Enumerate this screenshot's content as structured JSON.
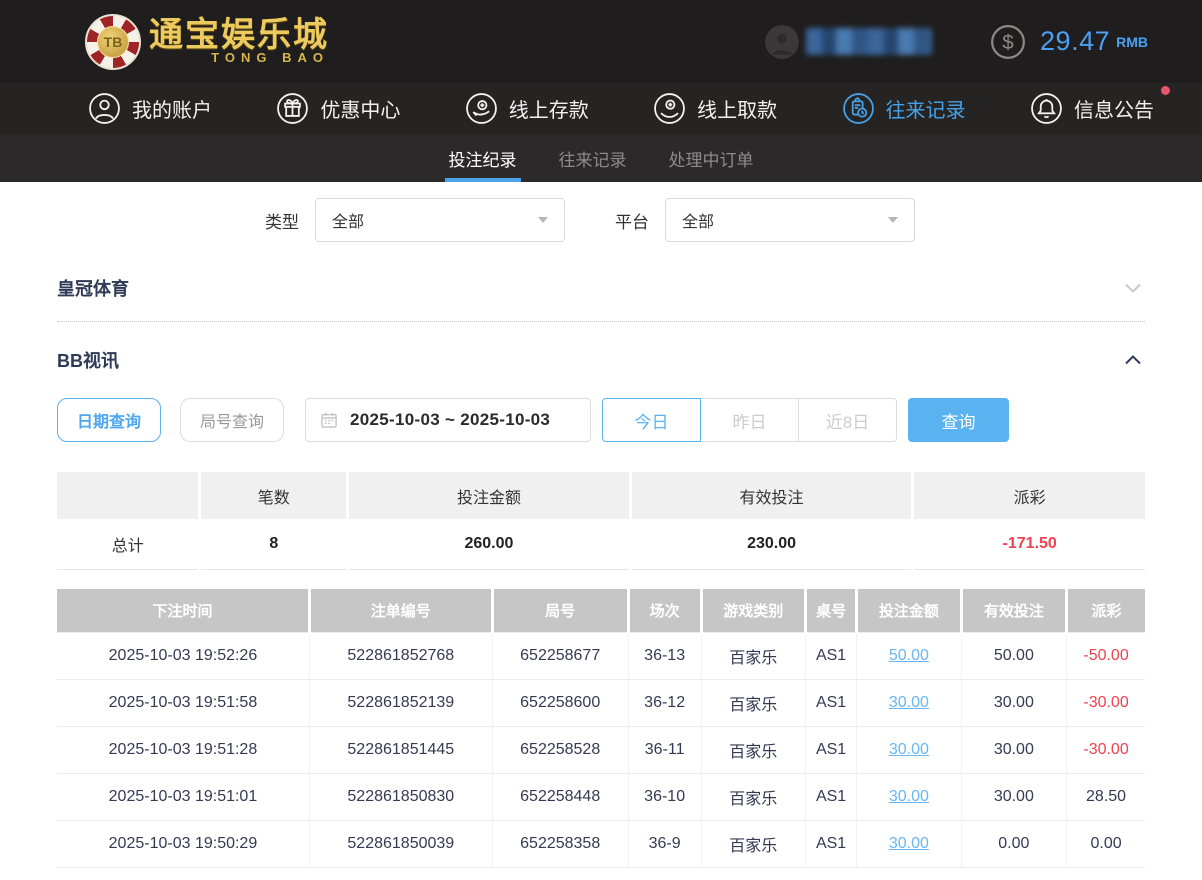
{
  "header": {
    "logo": {
      "chip_text": "TB",
      "name_cn": "通宝娱乐城",
      "name_en": "TONG BAO"
    },
    "balance": {
      "amount": "29.47",
      "currency": "RMB"
    },
    "colors": {
      "accent_blue": "#4aa0f2",
      "button_blue": "#5bb2f0",
      "negative_red": "#f0424f",
      "badge_pink": "#e8546a"
    }
  },
  "nav": {
    "items": [
      {
        "label": "我的账户",
        "icon": "user-icon"
      },
      {
        "label": "优惠中心",
        "icon": "gift-icon"
      },
      {
        "label": "线上存款",
        "icon": "deposit-icon"
      },
      {
        "label": "线上取款",
        "icon": "withdraw-icon"
      },
      {
        "label": "往来记录",
        "icon": "records-icon",
        "active": true
      },
      {
        "label": "信息公告",
        "icon": "bell-icon",
        "has_badge": true
      }
    ]
  },
  "tabs": {
    "items": [
      {
        "label": "投注纪录",
        "active": true
      },
      {
        "label": "往来记录"
      },
      {
        "label": "处理中订单"
      }
    ]
  },
  "filters": {
    "type": {
      "label": "类型",
      "value": "全部"
    },
    "platform": {
      "label": "平台",
      "value": "全部"
    }
  },
  "sections": {
    "crown": {
      "title": "皇冠体育",
      "state": "collapsed"
    },
    "bb": {
      "title": "BB视讯",
      "state": "expanded"
    }
  },
  "query": {
    "date_query_btn": "日期查询",
    "round_query_btn": "局号查询",
    "date_range": "2025-10-03 ~ 2025-10-03",
    "range_buttons": [
      {
        "label": "今日",
        "active": true
      },
      {
        "label": "昨日"
      },
      {
        "label": "近8日"
      }
    ],
    "search_btn": "查询"
  },
  "summary": {
    "headers": [
      "",
      "笔数",
      "投注金额",
      "有效投注",
      "派彩"
    ],
    "total_label": "总计",
    "count": "8",
    "bet_amount": "260.00",
    "valid_bet": "230.00",
    "payout": "-171.50"
  },
  "bet_table": {
    "headers": [
      "下注时间",
      "注单编号",
      "局号",
      "场次",
      "游戏类别",
      "桌号",
      "投注金额",
      "有效投注",
      "派彩"
    ],
    "rows": [
      {
        "time": "2025-10-03 19:52:26",
        "order_id": "522861852768",
        "round": "652258677",
        "session": "36-13",
        "game": "百家乐",
        "table": "AS1",
        "bet": "50.00",
        "valid": "50.00",
        "payout": "-50.00"
      },
      {
        "time": "2025-10-03 19:51:58",
        "order_id": "522861852139",
        "round": "652258600",
        "session": "36-12",
        "game": "百家乐",
        "table": "AS1",
        "bet": "30.00",
        "valid": "30.00",
        "payout": "-30.00"
      },
      {
        "time": "2025-10-03 19:51:28",
        "order_id": "522861851445",
        "round": "652258528",
        "session": "36-11",
        "game": "百家乐",
        "table": "AS1",
        "bet": "30.00",
        "valid": "30.00",
        "payout": "-30.00"
      },
      {
        "time": "2025-10-03 19:51:01",
        "order_id": "522861850830",
        "round": "652258448",
        "session": "36-10",
        "game": "百家乐",
        "table": "AS1",
        "bet": "30.00",
        "valid": "30.00",
        "payout": "28.50"
      },
      {
        "time": "2025-10-03 19:50:29",
        "order_id": "522861850039",
        "round": "652258358",
        "session": "36-9",
        "game": "百家乐",
        "table": "AS1",
        "bet": "30.00",
        "valid": "0.00",
        "payout": "0.00"
      }
    ]
  }
}
